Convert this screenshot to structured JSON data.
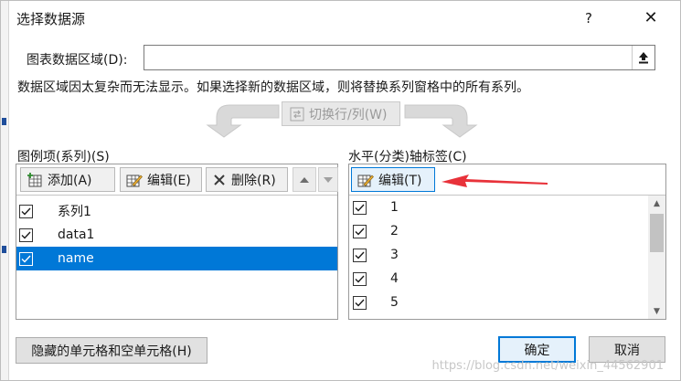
{
  "dialog": {
    "title": "选择数据源",
    "help_glyph": "?",
    "close_glyph": "✕"
  },
  "range": {
    "label": "图表数据区域(D):",
    "value": ""
  },
  "notice": "数据区域因太复杂而无法显示。如果选择新的数据区域，则将替换系列窗格中的所有系列。",
  "switch_button": "切换行/列(W)",
  "legend_panel": {
    "label": "图例项(系列)(S)",
    "add_label": "添加(A)",
    "edit_label": "编辑(E)",
    "delete_label": "删除(R)",
    "items": [
      {
        "label": "系列1",
        "checked": true,
        "selected": false
      },
      {
        "label": "data1",
        "checked": true,
        "selected": false
      },
      {
        "label": "name",
        "checked": true,
        "selected": true
      }
    ]
  },
  "axis_panel": {
    "label": "水平(分类)轴标签(C)",
    "edit_label": "编辑(T)",
    "items": [
      {
        "label": "1",
        "checked": true
      },
      {
        "label": "2",
        "checked": true
      },
      {
        "label": "3",
        "checked": true
      },
      {
        "label": "4",
        "checked": true
      },
      {
        "label": "5",
        "checked": true
      }
    ]
  },
  "footer": {
    "hidden_cells_label": "隐藏的单元格和空单元格(H)",
    "ok_label": "确定",
    "cancel_label": "取消"
  },
  "watermark": "https://blog.csdn.net/weixin_44562901",
  "colors": {
    "accent": "#0078d7",
    "annotation_arrow": "#e8323a"
  }
}
